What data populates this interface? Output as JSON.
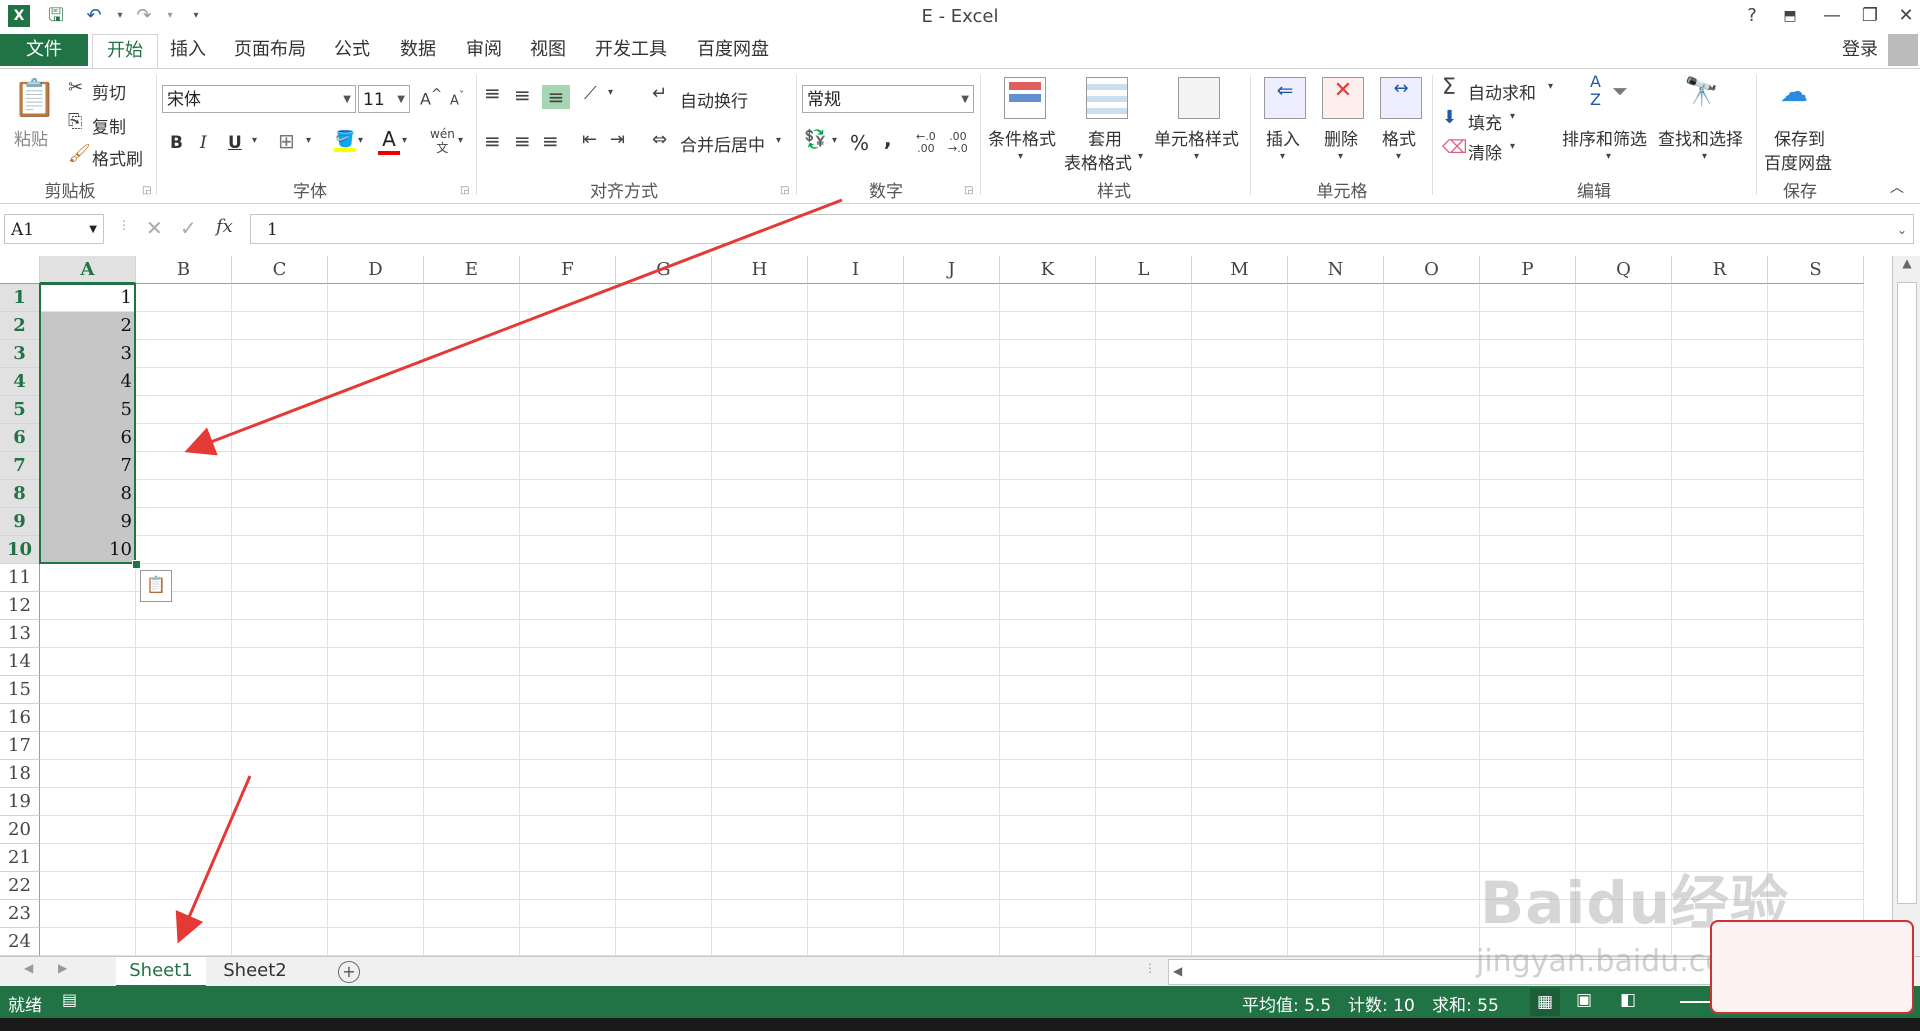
{
  "title": "E - Excel",
  "quick_access": {
    "excel_icon": "excel-logo-icon",
    "save": "save-icon",
    "undo": "undo-icon",
    "redo": "redo-icon"
  },
  "window": {
    "help": "?",
    "login": "登录"
  },
  "tabs": [
    {
      "label": "文件"
    },
    {
      "label": "开始"
    },
    {
      "label": "插入"
    },
    {
      "label": "页面布局"
    },
    {
      "label": "公式"
    },
    {
      "label": "数据"
    },
    {
      "label": "审阅"
    },
    {
      "label": "视图"
    },
    {
      "label": "开发工具"
    },
    {
      "label": "百度网盘"
    }
  ],
  "ribbon": {
    "clipboard": {
      "paste": "粘贴",
      "cut": "剪切",
      "copy": "复制",
      "format_painter": "格式刷",
      "group": "剪贴板"
    },
    "font": {
      "name": "宋体",
      "size": "11",
      "bold": "B",
      "italic": "I",
      "underline": "U",
      "group": "字体"
    },
    "alignment": {
      "wrap": "自动换行",
      "merge": "合并后居中",
      "group": "对齐方式"
    },
    "number": {
      "format": "常规",
      "percent": "%",
      "comma": ",",
      "group": "数字"
    },
    "styles": {
      "conditional": "条件格式",
      "table_1": "套用",
      "table_2": "表格格式",
      "cell_styles": "单元格样式",
      "group": "样式"
    },
    "cells": {
      "insert": "插入",
      "delete": "删除",
      "format": "格式",
      "group": "单元格"
    },
    "editing": {
      "autosum": "自动求和",
      "fill": "填充",
      "clear": "清除",
      "sort": "排序和筛选",
      "find": "查找和选择",
      "group": "编辑"
    },
    "save": {
      "line1": "保存到",
      "line2": "百度网盘",
      "group": "保存"
    }
  },
  "formula_bar": {
    "name_box": "A1",
    "fx": "fx",
    "value": "1"
  },
  "columns": [
    "A",
    "B",
    "C",
    "D",
    "E",
    "F",
    "G",
    "H",
    "I",
    "J",
    "K",
    "L",
    "M",
    "N",
    "O",
    "P",
    "Q",
    "R",
    "S"
  ],
  "rows": [
    "1",
    "2",
    "3",
    "4",
    "5",
    "6",
    "7",
    "8",
    "9",
    "10",
    "11",
    "12",
    "13",
    "14",
    "15",
    "16",
    "17",
    "18",
    "19",
    "20",
    "21",
    "22",
    "23",
    "24"
  ],
  "cells_a": [
    "1",
    "2",
    "3",
    "4",
    "5",
    "6",
    "7",
    "8",
    "9",
    "10"
  ],
  "sheets": [
    {
      "label": "Sheet1"
    },
    {
      "label": "Sheet2"
    }
  ],
  "status": {
    "ready": "就绪",
    "average": "平均值: 5.5",
    "count": "计数: 10",
    "sum": "求和: 55"
  },
  "watermark": {
    "text1": "Baidu经验",
    "text2": "jingyan.baidu.com"
  },
  "colors": {
    "accent": "#217346",
    "arrow": "#e53935"
  }
}
